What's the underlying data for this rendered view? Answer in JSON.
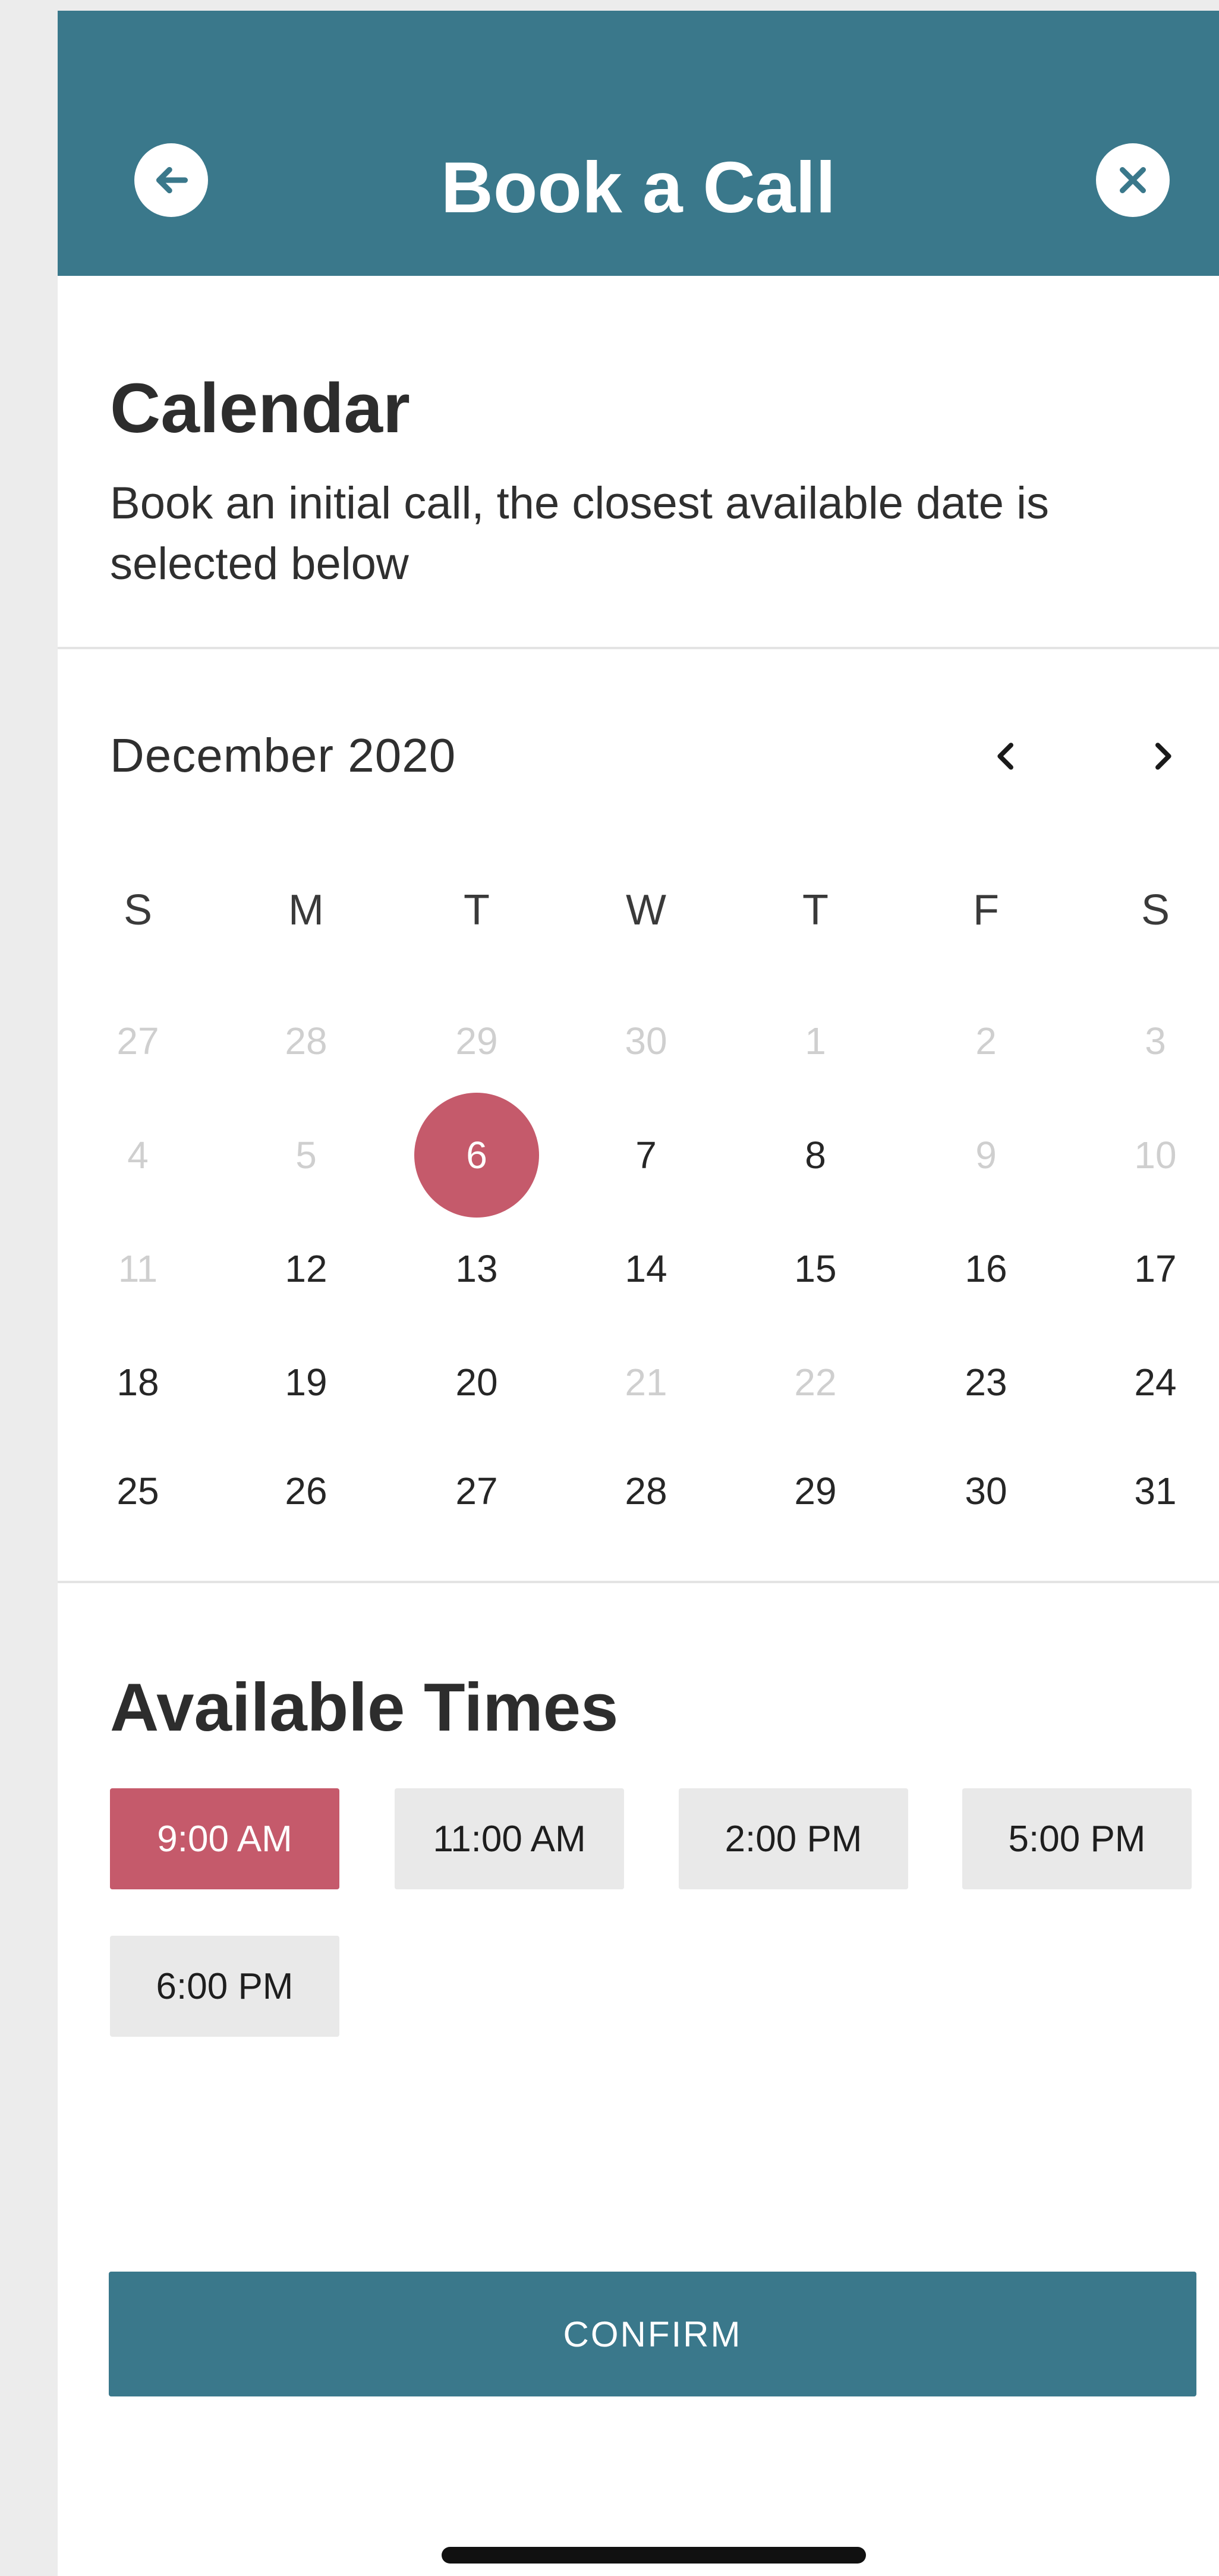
{
  "header": {
    "title": "Book a Call",
    "background": "#3a788b",
    "back_icon": "arrow-left-circle-icon",
    "close_icon": "x-circle-icon"
  },
  "calendar_section": {
    "heading": "Calendar",
    "description": "Book an initial call, the closest available date is selected below"
  },
  "calendar": {
    "month": "December 2020",
    "prev_icon": "chevron-left-icon",
    "next_icon": "chevron-right-icon",
    "weekdays": [
      "S",
      "M",
      "T",
      "W",
      "T",
      "F",
      "S"
    ],
    "selected_color": "#c55a6b",
    "weeks": [
      [
        {
          "label": "27",
          "muted": true
        },
        {
          "label": "28",
          "muted": true
        },
        {
          "label": "29",
          "muted": true
        },
        {
          "label": "30",
          "muted": true
        },
        {
          "label": "1",
          "muted": true
        },
        {
          "label": "2",
          "muted": true
        },
        {
          "label": "3",
          "muted": true
        }
      ],
      [
        {
          "label": "4",
          "muted": true
        },
        {
          "label": "5",
          "muted": true
        },
        {
          "label": "6",
          "selected": true
        },
        {
          "label": "7"
        },
        {
          "label": "8"
        },
        {
          "label": "9",
          "muted": true
        },
        {
          "label": "10",
          "muted": true
        }
      ],
      [
        {
          "label": "11",
          "muted": true
        },
        {
          "label": "12"
        },
        {
          "label": "13"
        },
        {
          "label": "14"
        },
        {
          "label": "15"
        },
        {
          "label": "16"
        },
        {
          "label": "17"
        }
      ],
      [
        {
          "label": "18"
        },
        {
          "label": "19"
        },
        {
          "label": "20"
        },
        {
          "label": "21",
          "muted": true
        },
        {
          "label": "22",
          "muted": true
        },
        {
          "label": "23"
        },
        {
          "label": "24"
        }
      ],
      [
        {
          "label": "25"
        },
        {
          "label": "26"
        },
        {
          "label": "27"
        },
        {
          "label": "28"
        },
        {
          "label": "29"
        },
        {
          "label": "30"
        },
        {
          "label": "31"
        }
      ]
    ]
  },
  "times_section": {
    "heading": "Available Times",
    "slots": [
      {
        "label": "9:00 AM",
        "selected": true
      },
      {
        "label": "11:00 AM"
      },
      {
        "label": "2:00 PM"
      },
      {
        "label": "5:00 PM"
      },
      {
        "label": "6:00 PM"
      }
    ]
  },
  "confirm_label": "CONFIRM"
}
